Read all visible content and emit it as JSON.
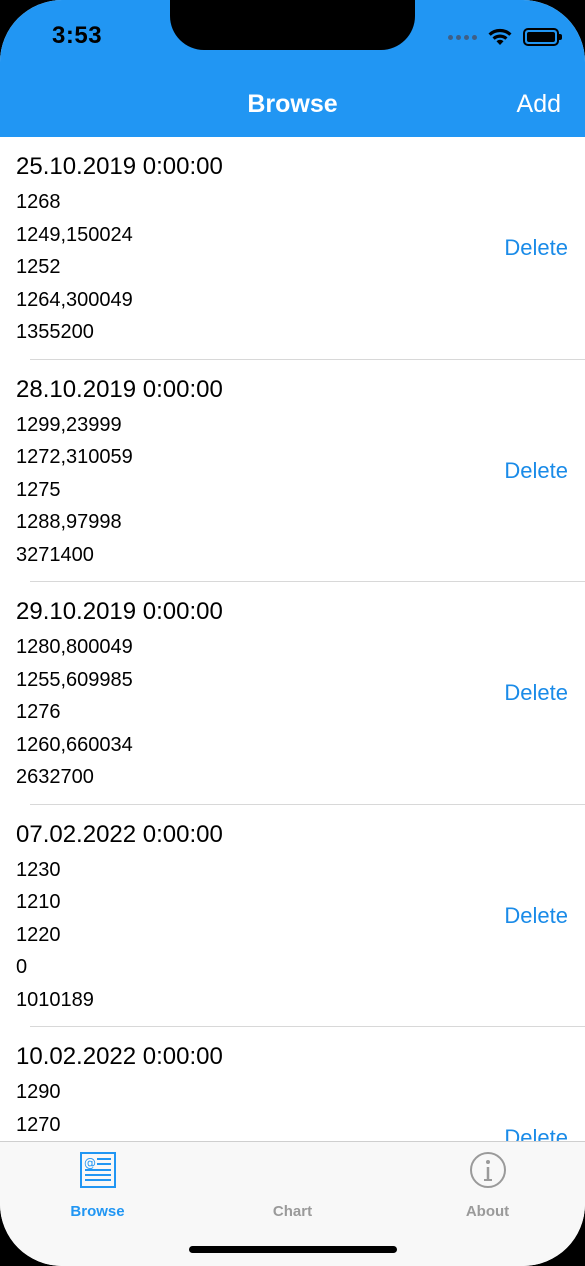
{
  "status_bar": {
    "time": "3:53"
  },
  "nav": {
    "title": "Browse",
    "add_label": "Add"
  },
  "rows": [
    {
      "date": "25.10.2019 0:00:00",
      "values": [
        "1268",
        "1249,150024",
        "1252",
        "1264,300049",
        "1355200"
      ],
      "delete_label": "Delete"
    },
    {
      "date": "28.10.2019 0:00:00",
      "values": [
        "1299,23999",
        "1272,310059",
        "1275",
        "1288,97998",
        "3271400"
      ],
      "delete_label": "Delete"
    },
    {
      "date": "29.10.2019 0:00:00",
      "values": [
        "1280,800049",
        "1255,609985",
        "1276",
        "1260,660034",
        "2632700"
      ],
      "delete_label": "Delete"
    },
    {
      "date": "07.02.2022 0:00:00",
      "values": [
        "1230",
        "1210",
        "1220",
        "0",
        "1010189"
      ],
      "delete_label": "Delete"
    },
    {
      "date": "10.02.2022 0:00:00",
      "values": [
        "1290",
        "1270",
        "",
        "",
        ""
      ],
      "delete_label": "Delete"
    }
  ],
  "tabs": [
    {
      "label": "Browse",
      "icon": "browse-icon",
      "active": true
    },
    {
      "label": "Chart",
      "icon": "chart-icon",
      "active": false
    },
    {
      "label": "About",
      "icon": "info-icon",
      "active": false
    }
  ],
  "colors": {
    "accent": "#2196F3",
    "delete": "#1a8be8",
    "inactive_tab": "#9a9a9a"
  }
}
